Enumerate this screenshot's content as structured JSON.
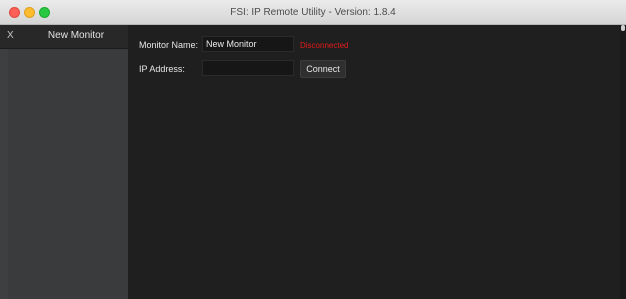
{
  "window": {
    "title": "FSI: IP Remote Utility - Version: 1.8.4"
  },
  "sidebar": {
    "close_label": "X",
    "items": [
      {
        "label": "New Monitor"
      }
    ]
  },
  "form": {
    "monitor_name_label": "Monitor Name:",
    "monitor_name_value": "New Monitor",
    "status": "Disconnected",
    "ip_address_label": "IP Address:",
    "ip_address_value": "",
    "connect_label": "Connect"
  },
  "colors": {
    "status_disconnected": "#e21b1b"
  }
}
